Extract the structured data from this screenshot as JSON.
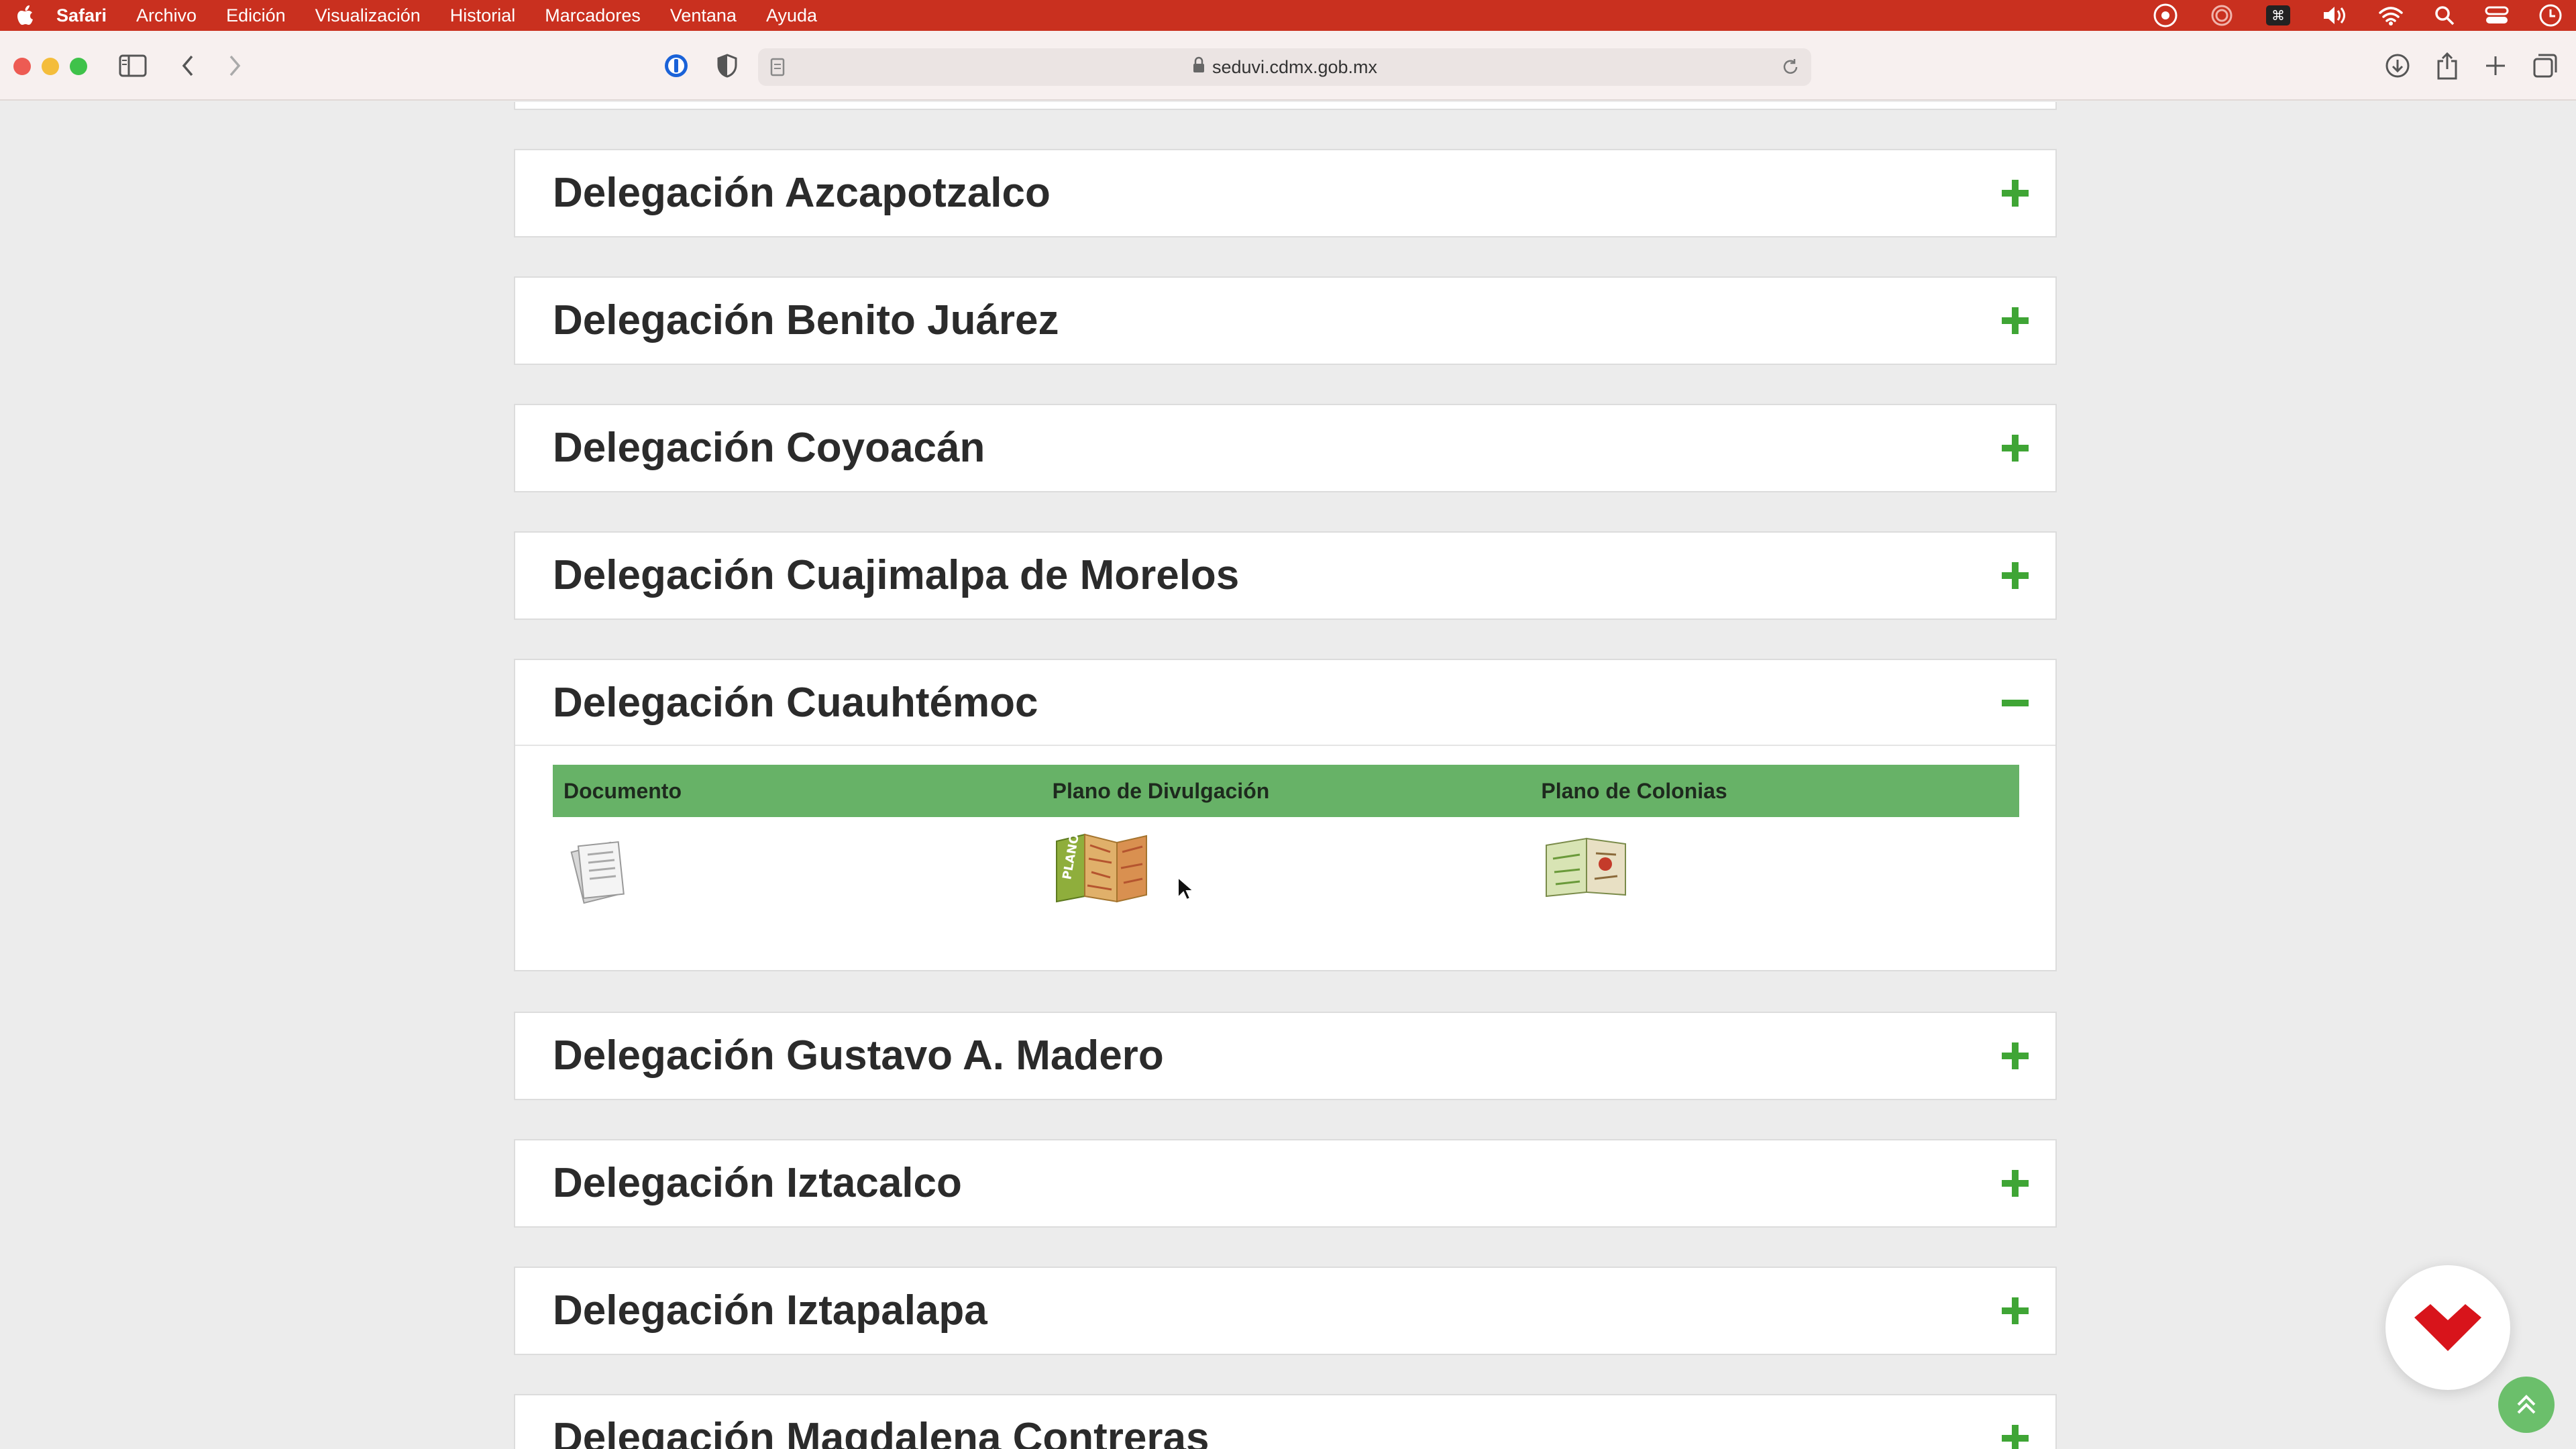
{
  "menubar": {
    "app_name": "Safari",
    "items": [
      "Archivo",
      "Edición",
      "Visualización",
      "Historial",
      "Marcadores",
      "Ventana",
      "Ayuda"
    ]
  },
  "toolbar": {
    "url": "seduvi.cdmx.gob.mx"
  },
  "panels": [
    {
      "title": "Delegación Azcapotzalco",
      "expanded": false
    },
    {
      "title": "Delegación Benito Juárez",
      "expanded": false
    },
    {
      "title": "Delegación Coyoacán",
      "expanded": false
    },
    {
      "title": "Delegación Cuajimalpa de Morelos",
      "expanded": false
    },
    {
      "title": "Delegación Cuauhtémoc",
      "expanded": true
    },
    {
      "title": "Delegación Gustavo A. Madero",
      "expanded": false
    },
    {
      "title": "Delegación Iztacalco",
      "expanded": false
    },
    {
      "title": "Delegación Iztapalapa",
      "expanded": false
    },
    {
      "title": "Delegación Magdalena Contreras",
      "expanded": false
    }
  ],
  "expanded_table": {
    "headers": [
      "Documento",
      "Plano de Divulgación",
      "Plano de Colonias"
    ],
    "icons": [
      "document-icon",
      "map-plano-icon",
      "colonias-map-icon"
    ]
  },
  "colors": {
    "menubar": "#c9301f",
    "accent_green": "#3fa535",
    "table_header": "#67b267"
  }
}
